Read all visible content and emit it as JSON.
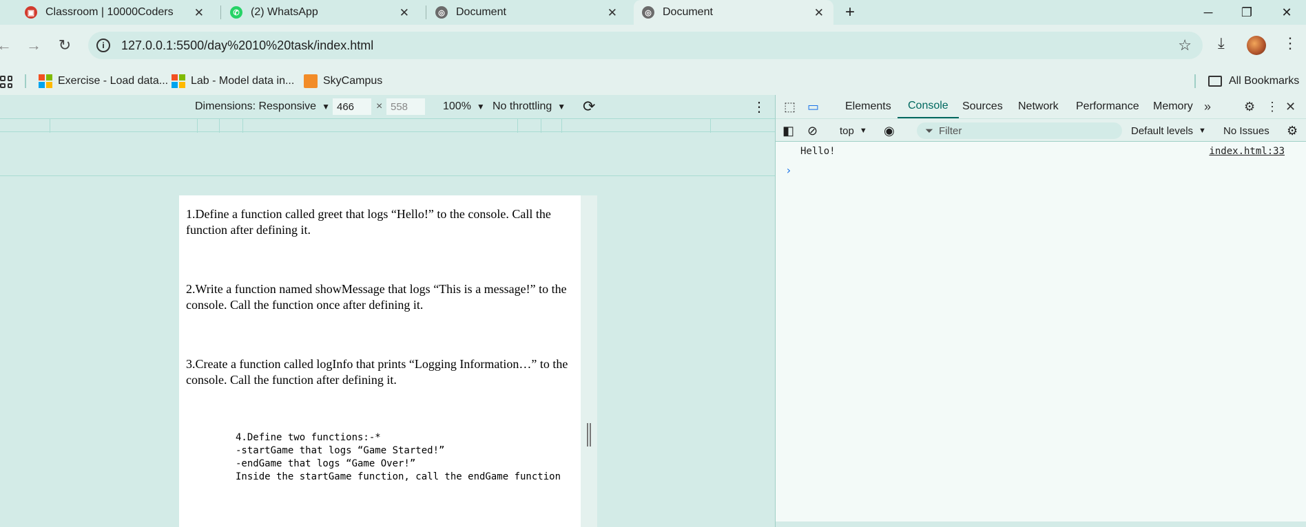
{
  "tabs": [
    {
      "title": "Classroom | 10000Coders",
      "icon": "classroom-favicon",
      "active": false
    },
    {
      "title": "(2) WhatsApp",
      "icon": "whatsapp-icon",
      "active": false
    },
    {
      "title": "Document",
      "icon": "globe-icon",
      "active": false
    },
    {
      "title": "Document",
      "icon": "globe-icon",
      "active": true
    }
  ],
  "toolbar": {
    "url": "127.0.0.1:5500/day%2010%20task/index.html"
  },
  "bookmarks": {
    "items": [
      {
        "label": "Exercise - Load data...",
        "icon": "microsoft-icon"
      },
      {
        "label": "Lab - Model data in...",
        "icon": "microsoft-icon"
      },
      {
        "label": "SkyCampus",
        "icon": "skycampus-icon"
      }
    ],
    "all_bookmarks": "All Bookmarks"
  },
  "device_toolbar": {
    "dimensions": "Dimensions: Responsive",
    "width_value": "466",
    "height_placeholder": "558",
    "times": "×",
    "zoom": "100%",
    "throttling": "No throttling"
  },
  "page": {
    "q1": "1.Define a function called greet that logs “Hello!” to the console. Call the function after defining it.",
    "q2": "2.Write a function named showMessage that logs “This is a message!” to the console. Call the function once after defining it.",
    "q3": "3.Create a function called logInfo that prints “Logging Information…” to the console. Call the function after defining it.",
    "q4_pre": "4.Define two functions:-*\n-startGame that logs “Game Started!”\n-endGame that logs “Game Over!”\nInside the startGame function, call the endGame function"
  },
  "devtools": {
    "tabs": [
      "Elements",
      "Console",
      "Sources",
      "Network",
      "Performance",
      "Memory"
    ],
    "active_tab": "Console",
    "context": "top",
    "filter_placeholder": "Filter",
    "levels": "Default levels",
    "issues": "No Issues",
    "console": {
      "message": "Hello!",
      "source": "index.html:33",
      "prompt": "›"
    }
  },
  "colors": {
    "chrome_bg": "#d3ebe7",
    "toolbar_bg": "#e4f1ee",
    "accent": "#00685f"
  }
}
